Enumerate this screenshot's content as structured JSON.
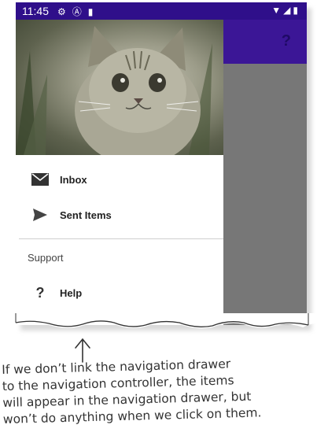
{
  "status_bar": {
    "time": "11:45",
    "left_icons": [
      "gear-icon",
      "a-icon",
      "sd-card-icon"
    ],
    "right_icons": [
      "wifi-icon",
      "signal-icon",
      "battery-icon"
    ]
  },
  "app_bar": {
    "help_icon": "?"
  },
  "drawer": {
    "items": [
      {
        "label": "Inbox",
        "icon": "envelope-icon"
      },
      {
        "label": "Sent Items",
        "icon": "send-icon"
      }
    ],
    "section_title": "Support",
    "support_items": [
      {
        "label": "Help",
        "icon": "help-icon",
        "glyph": "?"
      }
    ]
  },
  "annotation": {
    "lines": [
      "If we don’t link the navigation drawer",
      "to the navigation controller, the items",
      "will appear in the navigation drawer, but",
      "won’t do anything when we click on them."
    ]
  },
  "colors": {
    "status_bar": "#2f0f8a",
    "app_bar": "#3b1696",
    "scrim": "#777777"
  }
}
